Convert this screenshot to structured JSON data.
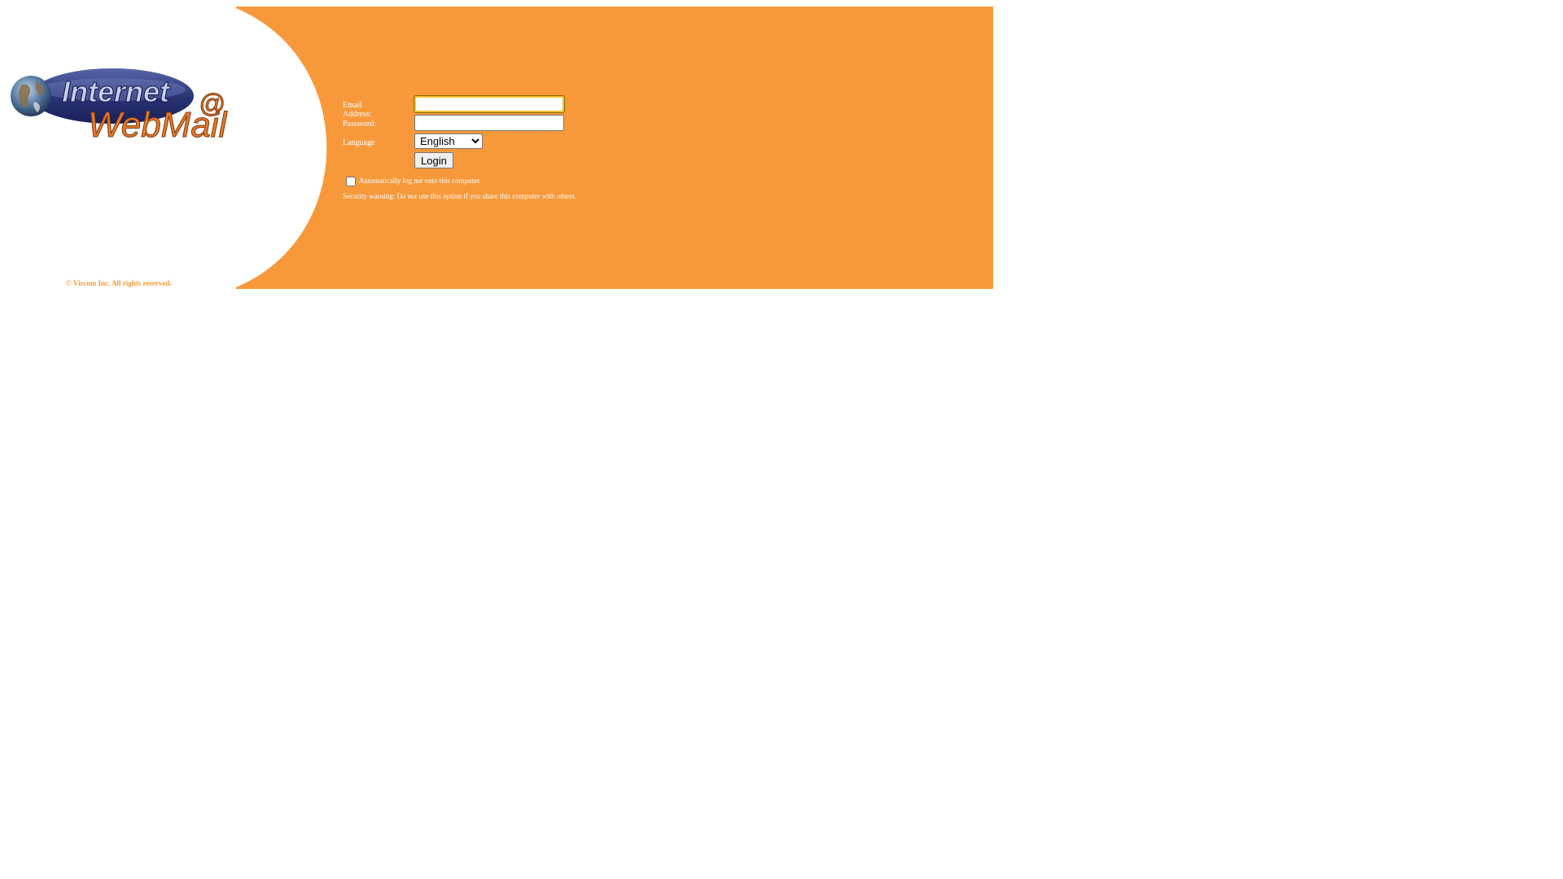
{
  "branding": {
    "logo_line1": "Internet",
    "logo_line2": "WebMail",
    "logo_symbol": "@",
    "globe_icon": "globe-icon",
    "copyright": "© Vircom Inc.  All rights reserved."
  },
  "colors": {
    "accent": "#f7993a",
    "input_focus": "#f2c230"
  },
  "login_form": {
    "email_label": "Email Address:",
    "email_value": "",
    "password_label": "Password:",
    "password_value": "",
    "language_label": "Language",
    "language_selected": "English",
    "login_button": "Login",
    "auto_login_label": "Automatically log me onto this computer.",
    "auto_login_checked": false,
    "security_warning": "Security warning: Do not use this option if you share this computer with others."
  }
}
